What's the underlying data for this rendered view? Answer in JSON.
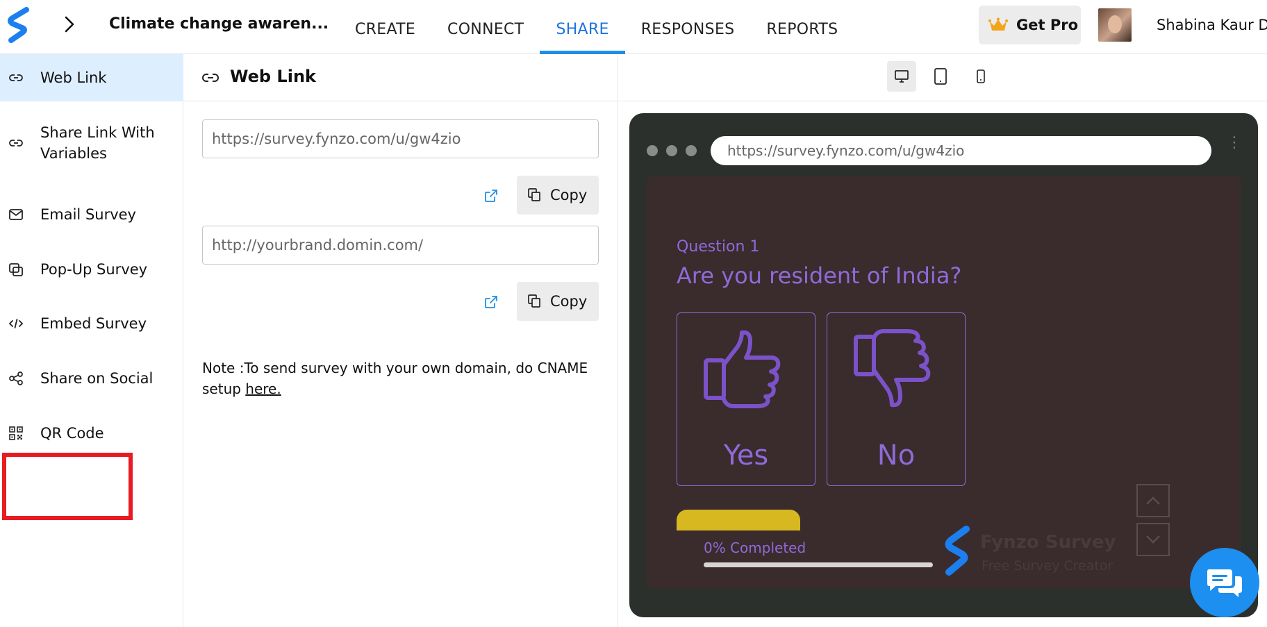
{
  "header": {
    "survey_title": "Climate change awaren...",
    "nav": [
      {
        "label": "CREATE",
        "active": false
      },
      {
        "label": "CONNECT",
        "active": false
      },
      {
        "label": "SHARE",
        "active": true
      },
      {
        "label": "RESPONSES",
        "active": false
      },
      {
        "label": "REPORTS",
        "active": false
      }
    ],
    "get_pro_label": "Get Pro",
    "user_name": "Shabina Kaur D"
  },
  "sidebar": {
    "items": [
      {
        "label": "Web Link",
        "icon": "link-icon",
        "active": true
      },
      {
        "label": "Share Link With Variables",
        "icon": "link-icon",
        "active": false
      },
      {
        "label": "Email Survey",
        "icon": "envelope-icon",
        "active": false
      },
      {
        "label": "Pop-Up Survey",
        "icon": "popup-icon",
        "active": false
      },
      {
        "label": "Embed Survey",
        "icon": "code-icon",
        "active": false
      },
      {
        "label": "Share on Social",
        "icon": "share-icon",
        "active": false
      },
      {
        "label": "QR Code",
        "icon": "qr-code-icon",
        "active": false,
        "highlighted": true
      }
    ]
  },
  "panel": {
    "title": "Web Link",
    "survey_url": "https://survey.fynzo.com/u/gw4zio",
    "custom_domain_url": "http://yourbrand.domin.com/",
    "copy_label": "Copy",
    "note_text": "Note :To send survey with your own domain, do CNAME setup ",
    "note_link": "here."
  },
  "preview": {
    "devices": [
      "desktop-icon",
      "tablet-icon",
      "mobile-icon"
    ],
    "active_device": "desktop-icon",
    "browser_url": "https://survey.fynzo.com/u/gw4zio",
    "question_number": "Question 1",
    "question_text": "Are you resident of India?",
    "options": [
      {
        "label": "Yes",
        "icon": "thumbs-up-icon"
      },
      {
        "label": "No",
        "icon": "thumbs-down-icon"
      }
    ],
    "progress_label": "0% Completed",
    "progress": 0,
    "brand_name": "Fynzo Survey",
    "brand_tagline": "Free Survey Creator"
  },
  "colors": {
    "accent": "#1c8fe8",
    "survey_bg": "#3a2b2c",
    "survey_text": "#8f6ad8",
    "highlight": "#e81b23"
  }
}
